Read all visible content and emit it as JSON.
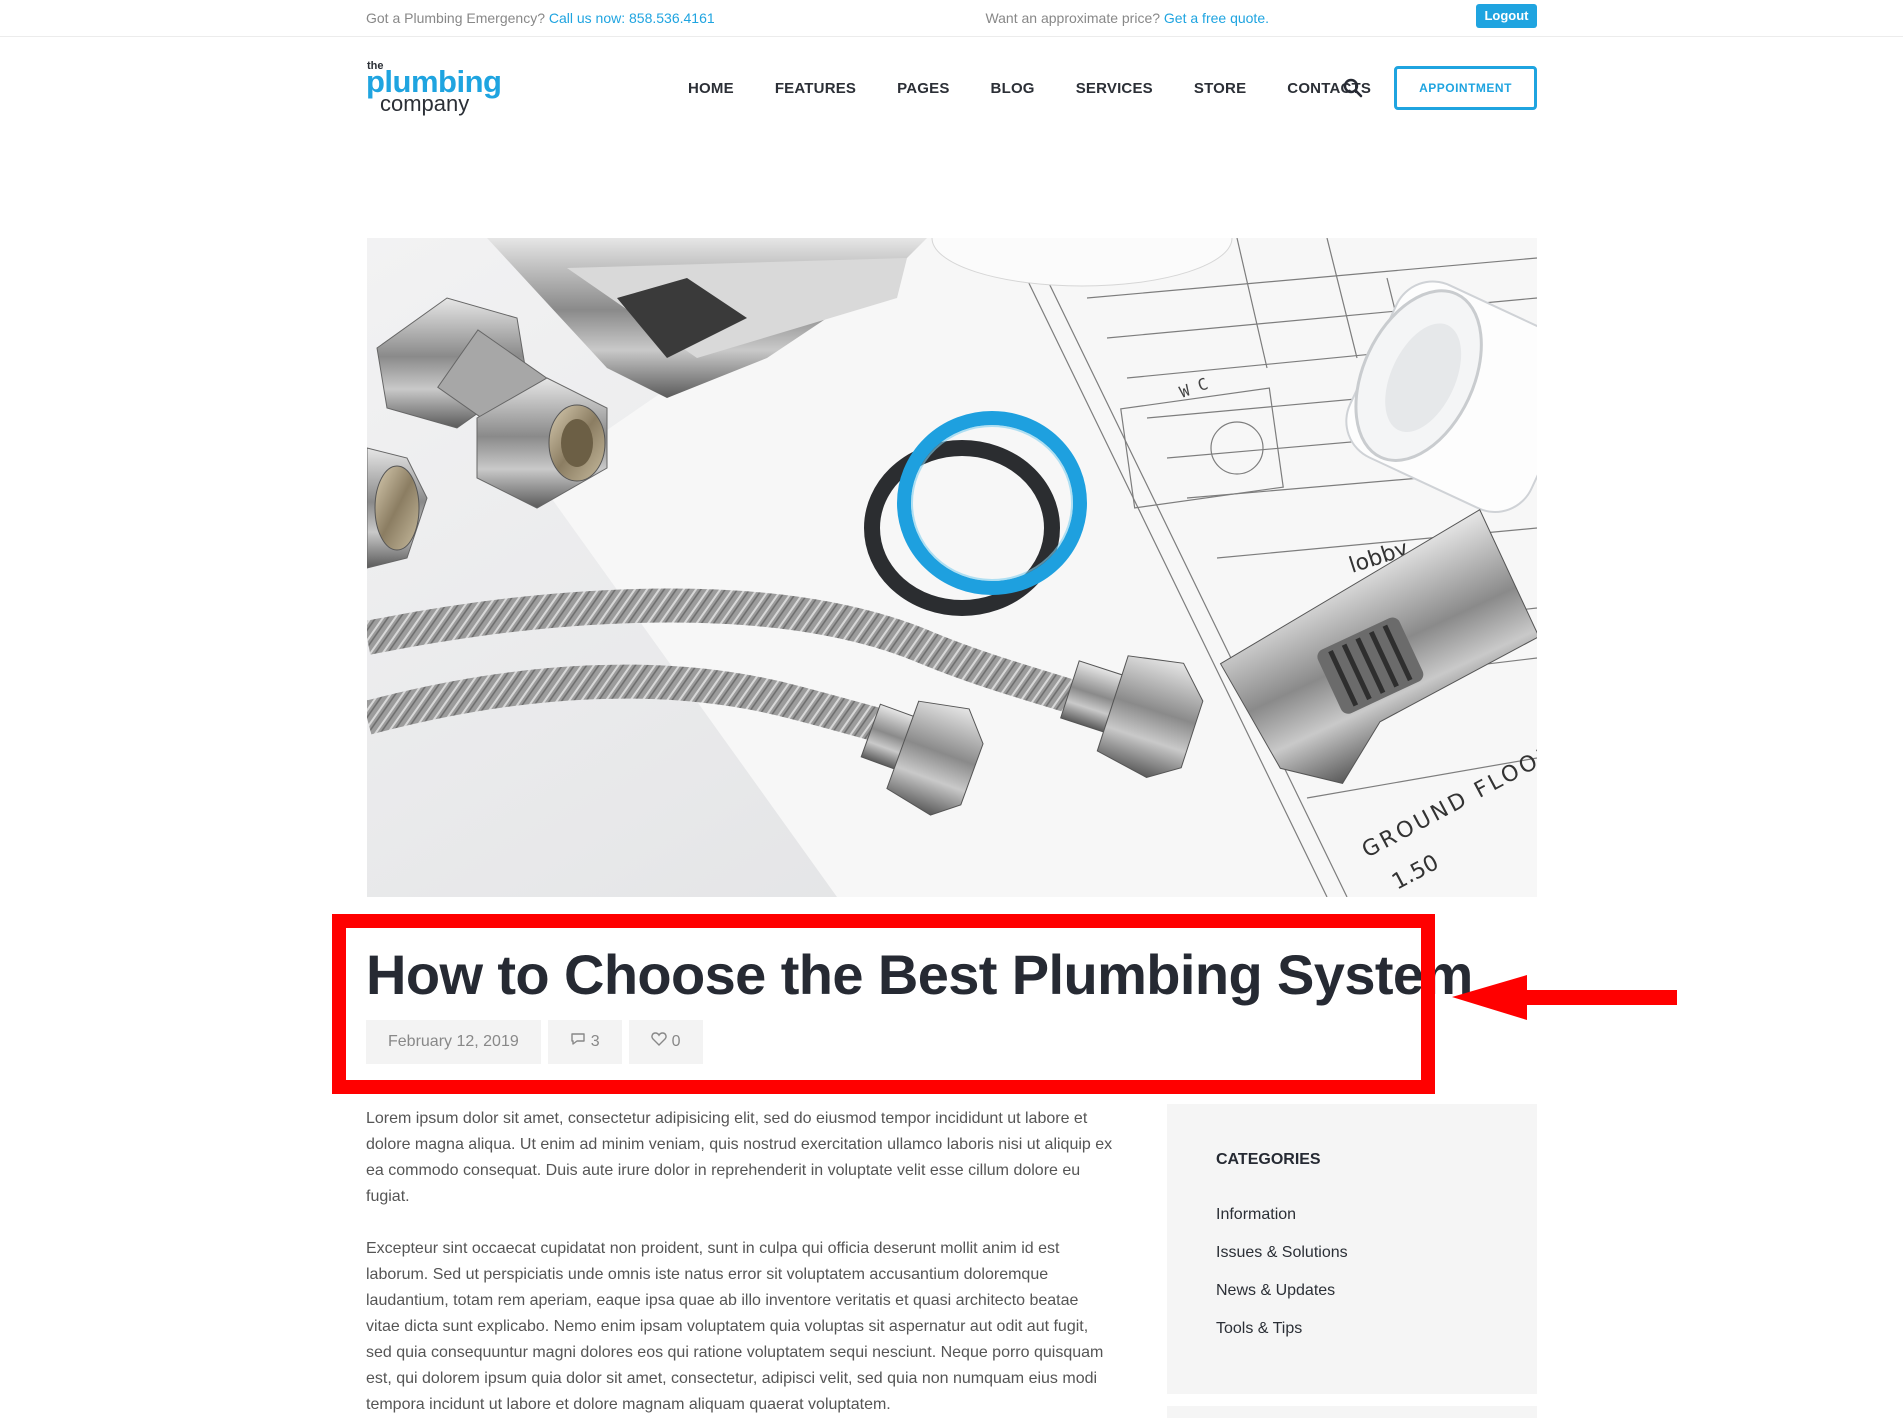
{
  "topbar": {
    "emergency_text": "Got a Plumbing Emergency?",
    "call_link": "Call us now: 858.536.4161",
    "price_text": "Want an approximate price?",
    "quote_link": "Get a free quote.",
    "logout": "Logout"
  },
  "logo": {
    "the": "the",
    "plumbing": "plumbing",
    "company": "company"
  },
  "nav": {
    "items": [
      "HOME",
      "FEATURES",
      "PAGES",
      "BLOG",
      "SERVICES",
      "STORE",
      "CONTACTS"
    ],
    "appointment": "APPOINTMENT"
  },
  "hero": {
    "floor_text": "GROUND FLOOR",
    "level_text": "1.50",
    "lobby": "lobby",
    "wc": "W C"
  },
  "post": {
    "title": "How to Choose the Best Plumbing System",
    "date": "February 12, 2019",
    "comments": "3",
    "likes": "0"
  },
  "content": {
    "p1": "Lorem ipsum dolor sit amet, consectetur adipisicing elit, sed do eiusmod tempor incididunt ut labore et dolore magna aliqua. Ut enim ad minim veniam, quis nostrud exercitation ullamco laboris nisi ut aliquip ex ea commodo consequat. Duis aute irure dolor in reprehenderit in voluptate velit esse cillum dolore eu fugiat.",
    "p2": "Excepteur sint occaecat cupidatat non proident, sunt in culpa qui officia deserunt mollit anim id est laborum. Sed ut perspiciatis unde omnis iste natus error sit voluptatem accusantium doloremque laudantium, totam rem aperiam, eaque ipsa quae ab illo inventore veritatis et quasi architecto beatae vitae dicta sunt explicabo. Nemo enim ipsam voluptatem quia voluptas sit aspernatur aut odit aut fugit, sed quia consequuntur magni dolores eos qui ratione voluptatem sequi nesciunt. Neque porro quisquam est, qui dolorem ipsum quia dolor sit amet, consectetur, adipisci velit, sed quia non numquam eius modi tempora incidunt ut labore et dolore magnam aliquam quaerat voluptatem."
  },
  "sidebar": {
    "heading": "CATEGORIES",
    "categories": [
      "Information",
      "Issues & Solutions",
      "News & Updates",
      "Tools & Tips"
    ]
  },
  "colors": {
    "accent": "#1fa4e0",
    "highlight": "#ff0000",
    "title": "#262a33"
  }
}
